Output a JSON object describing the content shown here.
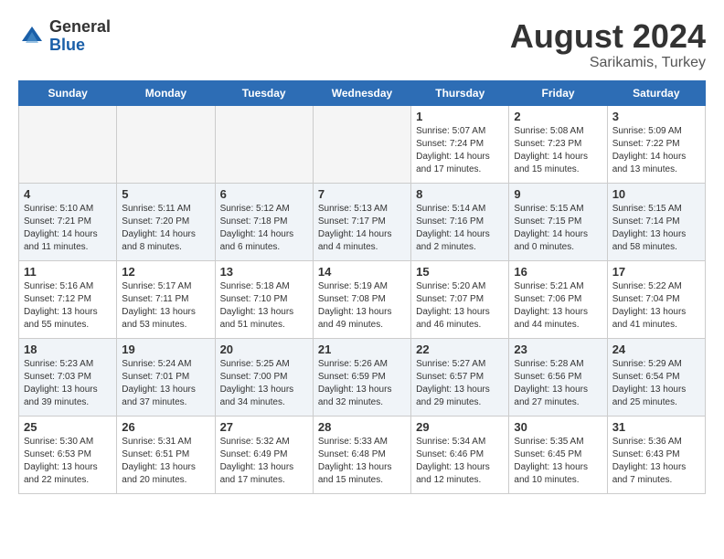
{
  "header": {
    "logo_line1": "General",
    "logo_line2": "Blue",
    "month_year": "August 2024",
    "location": "Sarikamis, Turkey"
  },
  "days_of_week": [
    "Sunday",
    "Monday",
    "Tuesday",
    "Wednesday",
    "Thursday",
    "Friday",
    "Saturday"
  ],
  "weeks": [
    [
      {
        "day": "",
        "info": ""
      },
      {
        "day": "",
        "info": ""
      },
      {
        "day": "",
        "info": ""
      },
      {
        "day": "",
        "info": ""
      },
      {
        "day": "1",
        "info": "Sunrise: 5:07 AM\nSunset: 7:24 PM\nDaylight: 14 hours\nand 17 minutes."
      },
      {
        "day": "2",
        "info": "Sunrise: 5:08 AM\nSunset: 7:23 PM\nDaylight: 14 hours\nand 15 minutes."
      },
      {
        "day": "3",
        "info": "Sunrise: 5:09 AM\nSunset: 7:22 PM\nDaylight: 14 hours\nand 13 minutes."
      }
    ],
    [
      {
        "day": "4",
        "info": "Sunrise: 5:10 AM\nSunset: 7:21 PM\nDaylight: 14 hours\nand 11 minutes."
      },
      {
        "day": "5",
        "info": "Sunrise: 5:11 AM\nSunset: 7:20 PM\nDaylight: 14 hours\nand 8 minutes."
      },
      {
        "day": "6",
        "info": "Sunrise: 5:12 AM\nSunset: 7:18 PM\nDaylight: 14 hours\nand 6 minutes."
      },
      {
        "day": "7",
        "info": "Sunrise: 5:13 AM\nSunset: 7:17 PM\nDaylight: 14 hours\nand 4 minutes."
      },
      {
        "day": "8",
        "info": "Sunrise: 5:14 AM\nSunset: 7:16 PM\nDaylight: 14 hours\nand 2 minutes."
      },
      {
        "day": "9",
        "info": "Sunrise: 5:15 AM\nSunset: 7:15 PM\nDaylight: 14 hours\nand 0 minutes."
      },
      {
        "day": "10",
        "info": "Sunrise: 5:15 AM\nSunset: 7:14 PM\nDaylight: 13 hours\nand 58 minutes."
      }
    ],
    [
      {
        "day": "11",
        "info": "Sunrise: 5:16 AM\nSunset: 7:12 PM\nDaylight: 13 hours\nand 55 minutes."
      },
      {
        "day": "12",
        "info": "Sunrise: 5:17 AM\nSunset: 7:11 PM\nDaylight: 13 hours\nand 53 minutes."
      },
      {
        "day": "13",
        "info": "Sunrise: 5:18 AM\nSunset: 7:10 PM\nDaylight: 13 hours\nand 51 minutes."
      },
      {
        "day": "14",
        "info": "Sunrise: 5:19 AM\nSunset: 7:08 PM\nDaylight: 13 hours\nand 49 minutes."
      },
      {
        "day": "15",
        "info": "Sunrise: 5:20 AM\nSunset: 7:07 PM\nDaylight: 13 hours\nand 46 minutes."
      },
      {
        "day": "16",
        "info": "Sunrise: 5:21 AM\nSunset: 7:06 PM\nDaylight: 13 hours\nand 44 minutes."
      },
      {
        "day": "17",
        "info": "Sunrise: 5:22 AM\nSunset: 7:04 PM\nDaylight: 13 hours\nand 41 minutes."
      }
    ],
    [
      {
        "day": "18",
        "info": "Sunrise: 5:23 AM\nSunset: 7:03 PM\nDaylight: 13 hours\nand 39 minutes."
      },
      {
        "day": "19",
        "info": "Sunrise: 5:24 AM\nSunset: 7:01 PM\nDaylight: 13 hours\nand 37 minutes."
      },
      {
        "day": "20",
        "info": "Sunrise: 5:25 AM\nSunset: 7:00 PM\nDaylight: 13 hours\nand 34 minutes."
      },
      {
        "day": "21",
        "info": "Sunrise: 5:26 AM\nSunset: 6:59 PM\nDaylight: 13 hours\nand 32 minutes."
      },
      {
        "day": "22",
        "info": "Sunrise: 5:27 AM\nSunset: 6:57 PM\nDaylight: 13 hours\nand 29 minutes."
      },
      {
        "day": "23",
        "info": "Sunrise: 5:28 AM\nSunset: 6:56 PM\nDaylight: 13 hours\nand 27 minutes."
      },
      {
        "day": "24",
        "info": "Sunrise: 5:29 AM\nSunset: 6:54 PM\nDaylight: 13 hours\nand 25 minutes."
      }
    ],
    [
      {
        "day": "25",
        "info": "Sunrise: 5:30 AM\nSunset: 6:53 PM\nDaylight: 13 hours\nand 22 minutes."
      },
      {
        "day": "26",
        "info": "Sunrise: 5:31 AM\nSunset: 6:51 PM\nDaylight: 13 hours\nand 20 minutes."
      },
      {
        "day": "27",
        "info": "Sunrise: 5:32 AM\nSunset: 6:49 PM\nDaylight: 13 hours\nand 17 minutes."
      },
      {
        "day": "28",
        "info": "Sunrise: 5:33 AM\nSunset: 6:48 PM\nDaylight: 13 hours\nand 15 minutes."
      },
      {
        "day": "29",
        "info": "Sunrise: 5:34 AM\nSunset: 6:46 PM\nDaylight: 13 hours\nand 12 minutes."
      },
      {
        "day": "30",
        "info": "Sunrise: 5:35 AM\nSunset: 6:45 PM\nDaylight: 13 hours\nand 10 minutes."
      },
      {
        "day": "31",
        "info": "Sunrise: 5:36 AM\nSunset: 6:43 PM\nDaylight: 13 hours\nand 7 minutes."
      }
    ]
  ]
}
